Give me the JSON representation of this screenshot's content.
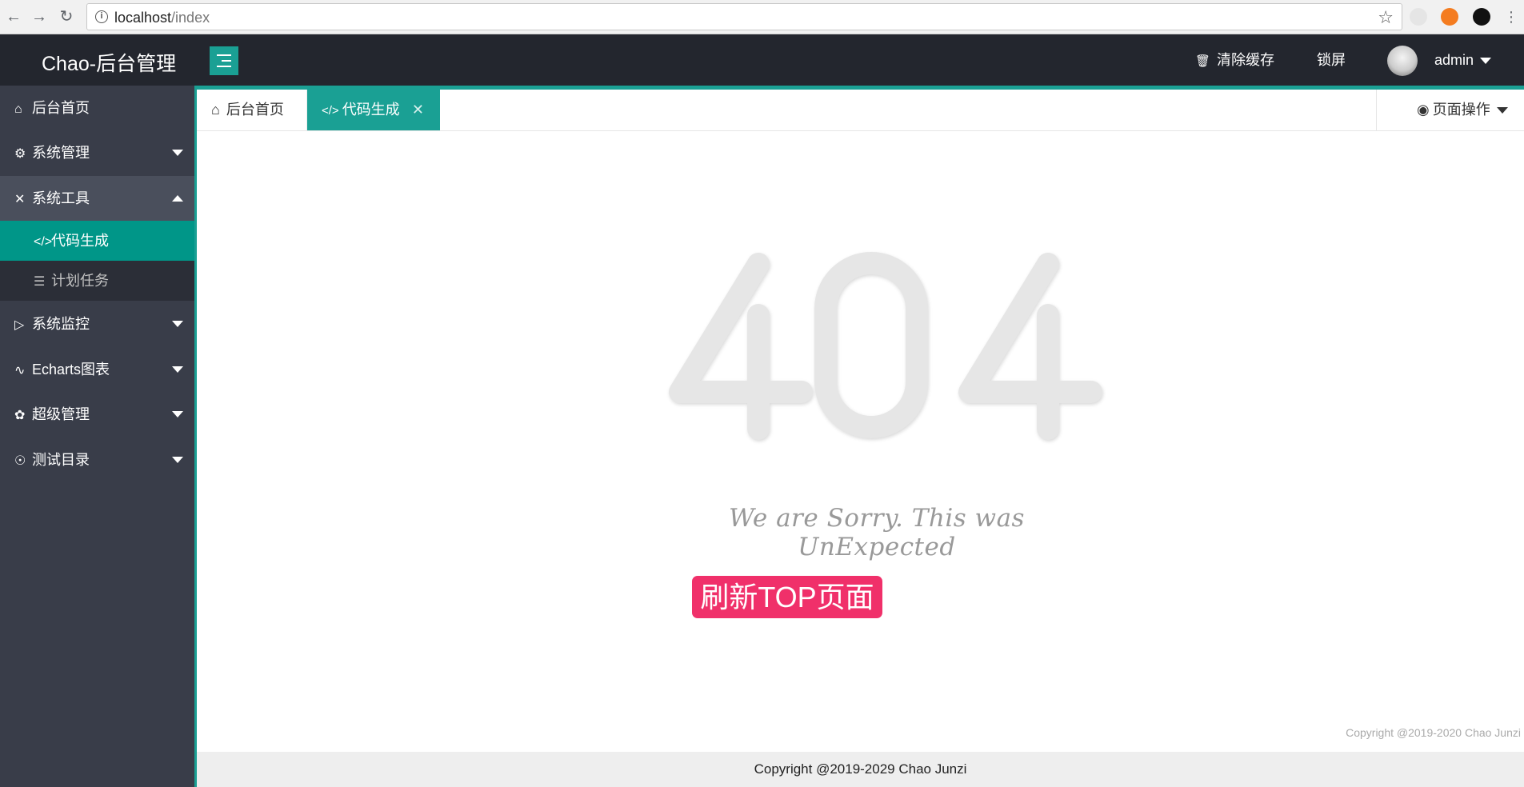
{
  "browser": {
    "url_host": "localhost",
    "url_path": "/index"
  },
  "header": {
    "logo": "Chao-后台管理",
    "clear_cache": "清除缓存",
    "lock_screen": "锁屏",
    "username": "admin"
  },
  "sidebar": {
    "items": [
      {
        "label": "后台首页",
        "icon": "home-icon"
      },
      {
        "label": "系统管理",
        "icon": "gear-icon"
      },
      {
        "label": "系统工具",
        "icon": "tools-icon"
      },
      {
        "label": "系统监控",
        "icon": "video-icon"
      },
      {
        "label": "Echarts图表",
        "icon": "pulse-icon"
      },
      {
        "label": "超级管理",
        "icon": "fire-icon"
      },
      {
        "label": "测试目录",
        "icon": "code-circle-icon"
      }
    ],
    "sub_items": [
      {
        "label": "代码生成",
        "icon": "code-icon"
      },
      {
        "label": "计划任务",
        "icon": "layers-icon"
      }
    ]
  },
  "tabs": {
    "home": "后台首页",
    "active": "代码生成",
    "page_ops": "页面操作"
  },
  "content": {
    "error_code": "404",
    "sorry_text": "We are Sorry. This was UnExpected",
    "refresh_button": "刷新TOP页面",
    "copyright_small": "Copyright @2019-2020 Chao Junzi"
  },
  "footer": {
    "text": "Copyright @2019-2029 Chao Junzi"
  },
  "colors": {
    "accent": "#1aa094",
    "header_bg": "#23262e",
    "sidebar_bg": "#393d49",
    "refresh_btn": "#f0306a"
  }
}
